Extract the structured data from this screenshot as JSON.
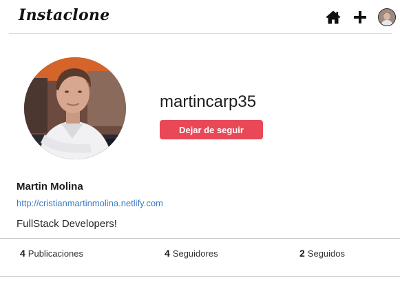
{
  "header": {
    "logo": "Instaclone",
    "icons": {
      "home": "home-icon",
      "add": "plus-icon",
      "avatar": "user-avatar-icon"
    }
  },
  "profile": {
    "username": "martincarp35",
    "unfollow_label": "Dejar de seguir",
    "full_name": "Martin Molina",
    "website": "http://cristianmartinmolina.netlify.com",
    "bio": "FullStack Developers!"
  },
  "stats": {
    "posts": {
      "count": "4",
      "label": "Publicaciones"
    },
    "followers": {
      "count": "4",
      "label": "Seguidores"
    },
    "following": {
      "count": "2",
      "label": "Seguidos"
    }
  },
  "colors": {
    "accent": "#e94857",
    "link": "#3b7ac2"
  }
}
